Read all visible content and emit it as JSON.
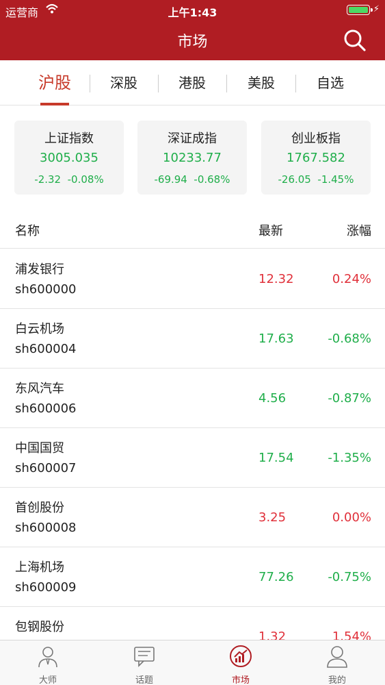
{
  "status_bar": {
    "carrier": "运营商",
    "time": "上午1:43",
    "battery_level": 1.0,
    "colors": {
      "battery": "#4cd964"
    }
  },
  "header": {
    "title": "市场",
    "background": "#b01d23",
    "search_icon": "search-icon"
  },
  "market_tabs": [
    {
      "label": "沪股",
      "active": true
    },
    {
      "label": "深股",
      "active": false
    },
    {
      "label": "港股",
      "active": false
    },
    {
      "label": "美股",
      "active": false
    },
    {
      "label": "自选",
      "active": false
    }
  ],
  "indices": [
    {
      "name": "上证指数",
      "price": "3005.035",
      "change": "-2.32",
      "change_pct": "-0.08%"
    },
    {
      "name": "深证成指",
      "price": "10233.77",
      "change": "-69.94",
      "change_pct": "-0.68%"
    },
    {
      "name": "创业板指",
      "price": "1767.582",
      "change": "-26.05",
      "change_pct": "-1.45%"
    }
  ],
  "list_header": {
    "name": "名称",
    "latest": "最新",
    "change": "涨幅"
  },
  "stocks": [
    {
      "name": "浦发银行",
      "code": "sh600000",
      "latest": "12.32",
      "change": "0.24%",
      "trend": "up"
    },
    {
      "name": "白云机场",
      "code": "sh600004",
      "latest": "17.63",
      "change": "-0.68%",
      "trend": "down"
    },
    {
      "name": "东风汽车",
      "code": "sh600006",
      "latest": "4.56",
      "change": "-0.87%",
      "trend": "down"
    },
    {
      "name": "中国国贸",
      "code": "sh600007",
      "latest": "17.54",
      "change": "-1.35%",
      "trend": "down"
    },
    {
      "name": "首创股份",
      "code": "sh600008",
      "latest": "3.25",
      "change": "0.00%",
      "trend": "up"
    },
    {
      "name": "上海机场",
      "code": "sh600009",
      "latest": "77.26",
      "change": "-0.75%",
      "trend": "down"
    },
    {
      "name": "包钢股份",
      "code": "",
      "latest": "1.32",
      "change": "1.54%",
      "trend": "up"
    }
  ],
  "tab_bar": [
    {
      "label": "大师",
      "icon": "master-icon",
      "active": false
    },
    {
      "label": "话题",
      "icon": "topic-icon",
      "active": false
    },
    {
      "label": "市场",
      "icon": "market-icon",
      "active": true
    },
    {
      "label": "我的",
      "icon": "profile-icon",
      "active": false
    }
  ],
  "colors": {
    "up": "#e0303a",
    "down": "#1fae4a",
    "accent": "#c73a2a"
  }
}
